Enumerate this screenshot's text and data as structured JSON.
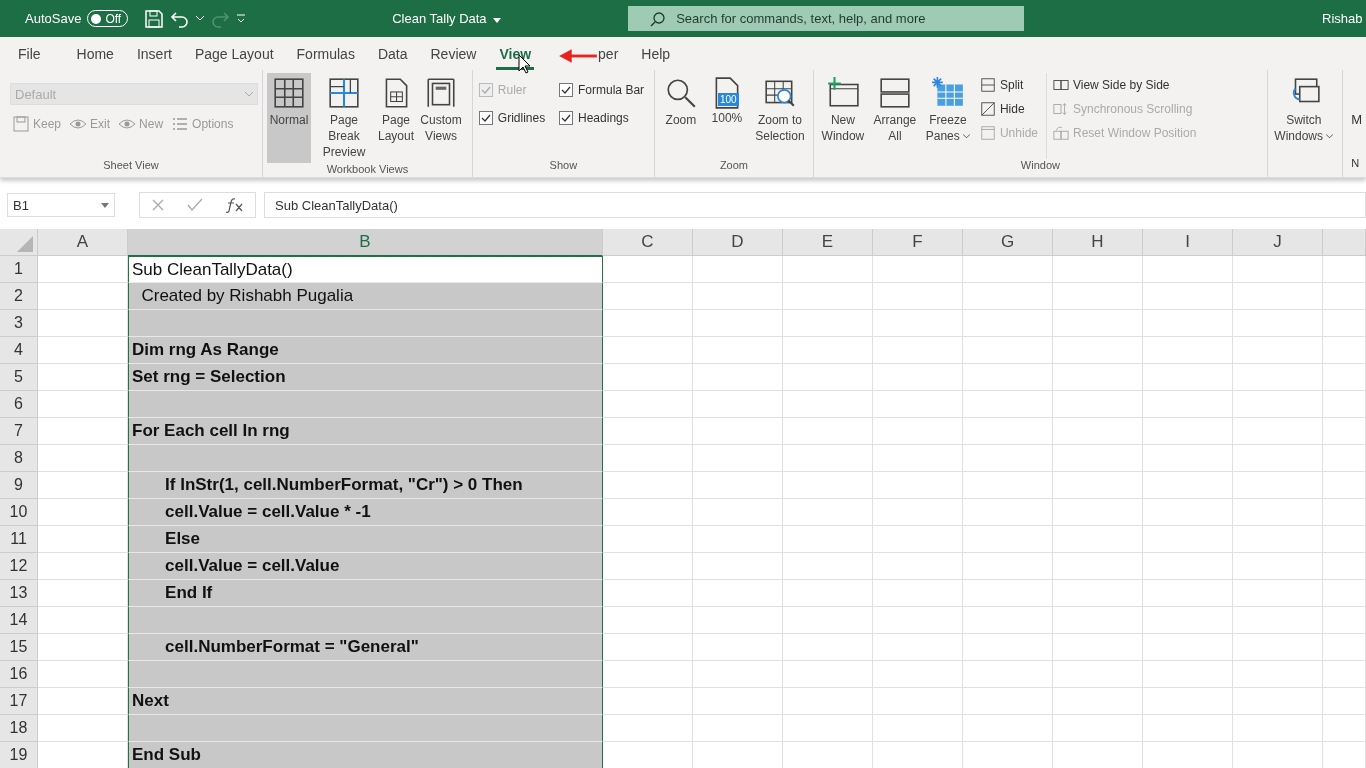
{
  "title_bar": {
    "autosave_label": "AutoSave",
    "autosave_toggle": {
      "label": "Off",
      "on": false
    },
    "title": "Clean Tally Data",
    "search": {
      "placeholder": "Search for commands, text, help, and more"
    },
    "user": "Rishab"
  },
  "tabs": [
    {
      "label": "File",
      "selected": false
    },
    {
      "label": "Home",
      "selected": false
    },
    {
      "label": "Insert",
      "selected": false
    },
    {
      "label": "Page Layout",
      "selected": false
    },
    {
      "label": "Formulas",
      "selected": false
    },
    {
      "label": "Data",
      "selected": false
    },
    {
      "label": "Review",
      "selected": false
    },
    {
      "label": "View",
      "selected": true
    },
    {
      "label": "per",
      "selected": false
    },
    {
      "label": "Help",
      "selected": false
    }
  ],
  "ribbon": {
    "sheet_view": {
      "label": "Sheet View",
      "dropdown": {
        "value": "Default",
        "disabled": true
      },
      "buttons": [
        {
          "label": "Keep",
          "disabled": true
        },
        {
          "label": "Exit",
          "disabled": true
        },
        {
          "label": "New",
          "disabled": true
        },
        {
          "label": "Options",
          "disabled": true
        }
      ]
    },
    "workbook_views": {
      "label": "Workbook Views",
      "buttons": [
        {
          "label": "Normal",
          "selected": true
        },
        {
          "label": "Page Break Preview",
          "selected": false
        },
        {
          "label": "Page Layout",
          "selected": false
        },
        {
          "label": "Custom Views",
          "selected": false
        }
      ]
    },
    "show": {
      "label": "Show",
      "checkboxes": [
        {
          "label": "Ruler",
          "checked": true,
          "disabled": true
        },
        {
          "label": "Formula Bar",
          "checked": true,
          "disabled": false
        },
        {
          "label": "Gridlines",
          "checked": true,
          "disabled": false
        },
        {
          "label": "Headings",
          "checked": true,
          "disabled": false
        }
      ]
    },
    "zoom": {
      "label": "Zoom",
      "buttons": [
        {
          "label": "Zoom"
        },
        {
          "label": "100%",
          "icon_text": "100"
        },
        {
          "label": "Zoom to Selection"
        }
      ]
    },
    "window": {
      "label": "Window",
      "large_buttons": [
        {
          "label": "New Window",
          "dropdown": false
        },
        {
          "label": "Arrange All",
          "dropdown": false
        },
        {
          "label": "Freeze Panes",
          "dropdown": true
        }
      ],
      "small_buttons": [
        {
          "label": "Split",
          "disabled": false
        },
        {
          "label": "Hide",
          "disabled": false
        },
        {
          "label": "Unhide",
          "disabled": true
        },
        {
          "label": "View Side by Side",
          "disabled": false
        },
        {
          "label": "Synchronous Scrolling",
          "disabled": true
        },
        {
          "label": "Reset Window Position",
          "disabled": true
        }
      ],
      "switch_button": {
        "label": "Switch Windows",
        "dropdown": true
      }
    },
    "cut_group": {
      "button_label": "M",
      "label": "N"
    }
  },
  "formula_bar": {
    "name_box": "B1",
    "formula": "Sub CleanTallyData()"
  },
  "columns": [
    {
      "label": "A",
      "selected": false
    },
    {
      "label": "B",
      "selected": true
    },
    {
      "label": "C",
      "selected": false
    },
    {
      "label": "D",
      "selected": false
    },
    {
      "label": "E",
      "selected": false
    },
    {
      "label": "F",
      "selected": false
    },
    {
      "label": "G",
      "selected": false
    },
    {
      "label": "H",
      "selected": false
    },
    {
      "label": "I",
      "selected": false
    },
    {
      "label": "J",
      "selected": false
    }
  ],
  "rows": [
    {
      "number": "1",
      "b": "Sub CleanTallyData()",
      "bold": false,
      "active": true
    },
    {
      "number": "2",
      "b": "  Created by Rishabh Pugalia",
      "bold": false,
      "active": false
    },
    {
      "number": "3",
      "b": "",
      "active": false
    },
    {
      "number": "4",
      "b": "Dim rng As Range",
      "bold": true,
      "active": false
    },
    {
      "number": "5",
      "b": "Set rng = Selection",
      "bold": true,
      "active": false
    },
    {
      "number": "6",
      "b": "",
      "active": false
    },
    {
      "number": "7",
      "b": "For Each cell In rng",
      "bold": true,
      "active": false
    },
    {
      "number": "8",
      "b": "",
      "active": false
    },
    {
      "number": "9",
      "b": "       If InStr(1, cell.NumberFormat, \"Cr\") > 0 Then",
      "bold": true,
      "active": false
    },
    {
      "number": "10",
      "b": "       cell.Value = cell.Value * -1",
      "bold": true,
      "active": false
    },
    {
      "number": "11",
      "b": "       Else",
      "bold": true,
      "active": false
    },
    {
      "number": "12",
      "b": "       cell.Value = cell.Value",
      "bold": true,
      "active": false
    },
    {
      "number": "13",
      "b": "       End If",
      "bold": true,
      "active": false
    },
    {
      "number": "14",
      "b": "",
      "active": false
    },
    {
      "number": "15",
      "b": "       cell.NumberFormat = \"General\"",
      "bold": true,
      "active": false
    },
    {
      "number": "16",
      "b": "",
      "active": false
    },
    {
      "number": "17",
      "b": "Next",
      "bold": true,
      "active": false
    },
    {
      "number": "18",
      "b": "",
      "active": false
    },
    {
      "number": "19",
      "b": "End Sub",
      "bold": true,
      "active": false
    }
  ]
}
